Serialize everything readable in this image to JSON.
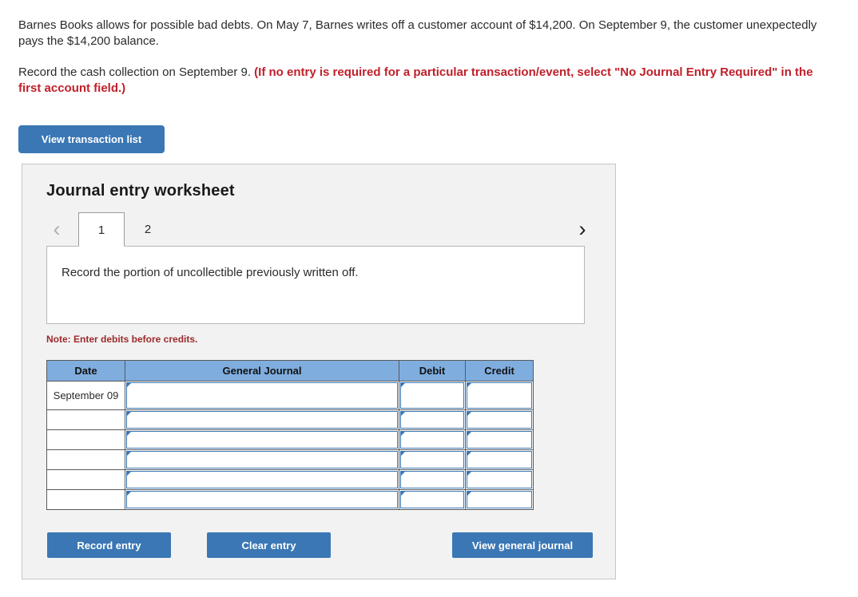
{
  "problem": {
    "paragraph1": "Barnes Books allows for possible bad debts. On May 7, Barnes writes off a customer account of $14,200. On September 9, the customer unexpectedly pays the $14,200 balance.",
    "paragraph2_normal": "Record the cash collection on September 9. ",
    "paragraph2_emphasis": "(If no entry is required for a particular transaction/event, select \"No Journal Entry Required\" in the first account field.)"
  },
  "toolbar": {
    "view_transaction_list_label": "View transaction list"
  },
  "worksheet": {
    "title": "Journal entry worksheet",
    "nav": {
      "prev_icon": "chevron-left-icon",
      "prev_glyph": "‹",
      "next_icon": "chevron-right-icon",
      "next_glyph": "›"
    },
    "tabs": [
      {
        "label": "1",
        "active": true
      },
      {
        "label": "2",
        "active": false
      }
    ],
    "instruction": "Record the portion of uncollectible previously written off.",
    "note": "Note: Enter debits before credits.",
    "table": {
      "headers": [
        "Date",
        "General Journal",
        "Debit",
        "Credit"
      ],
      "rows": [
        {
          "date": "September 09",
          "general_journal": "",
          "debit": "",
          "credit": ""
        },
        {
          "date": "",
          "general_journal": "",
          "debit": "",
          "credit": ""
        },
        {
          "date": "",
          "general_journal": "",
          "debit": "",
          "credit": ""
        },
        {
          "date": "",
          "general_journal": "",
          "debit": "",
          "credit": ""
        },
        {
          "date": "",
          "general_journal": "",
          "debit": "",
          "credit": ""
        },
        {
          "date": "",
          "general_journal": "",
          "debit": "",
          "credit": ""
        }
      ]
    },
    "actions": {
      "record_entry_label": "Record entry",
      "clear_entry_label": "Clear entry",
      "view_general_journal_label": "View general journal"
    }
  },
  "colors": {
    "button_blue": "#3b77b4",
    "table_header_blue": "#7fadde",
    "emphasis_red": "#c0202a",
    "note_red": "#9c2a2a",
    "panel_bg": "#f2f2f2"
  }
}
